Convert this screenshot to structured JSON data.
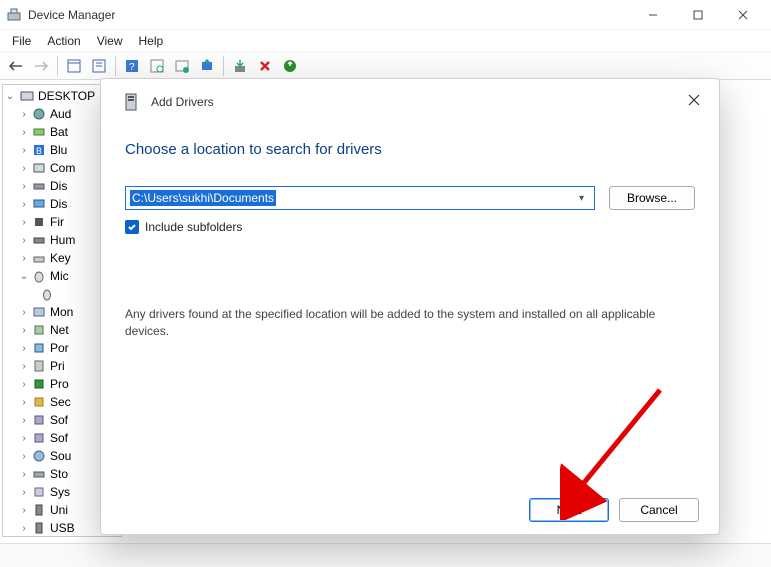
{
  "window": {
    "title": "Device Manager",
    "menu": [
      "File",
      "Action",
      "View",
      "Help"
    ]
  },
  "tree": {
    "root": "DESKTOP",
    "items": [
      {
        "label": "Audio"
      },
      {
        "label": "Batteries"
      },
      {
        "label": "Bluetooth"
      },
      {
        "label": "Computer"
      },
      {
        "label": "Disk drives"
      },
      {
        "label": "Display"
      },
      {
        "label": "Firmware"
      },
      {
        "label": "Human"
      },
      {
        "label": "Keyboards"
      },
      {
        "label": "Mice",
        "expanded": true,
        "children": [
          {
            "label": ""
          }
        ]
      },
      {
        "label": "Monitors"
      },
      {
        "label": "Network"
      },
      {
        "label": "Portables"
      },
      {
        "label": "Print"
      },
      {
        "label": "Processors"
      },
      {
        "label": "Security"
      },
      {
        "label": "Software"
      },
      {
        "label": "Software"
      },
      {
        "label": "Sound"
      },
      {
        "label": "Storage"
      },
      {
        "label": "System"
      },
      {
        "label": "Universal"
      },
      {
        "label": "USB"
      }
    ]
  },
  "dialog": {
    "title": "Add Drivers",
    "heading": "Choose a location to search for drivers",
    "path_value": "C:\\Users\\sukhi\\Documents",
    "browse_label": "Browse...",
    "include_label": "Include subfolders",
    "include_checked": true,
    "info_text": "Any drivers found at the specified location will be added to the system and installed on all applicable devices.",
    "next_label": "Next",
    "cancel_label": "Cancel"
  }
}
